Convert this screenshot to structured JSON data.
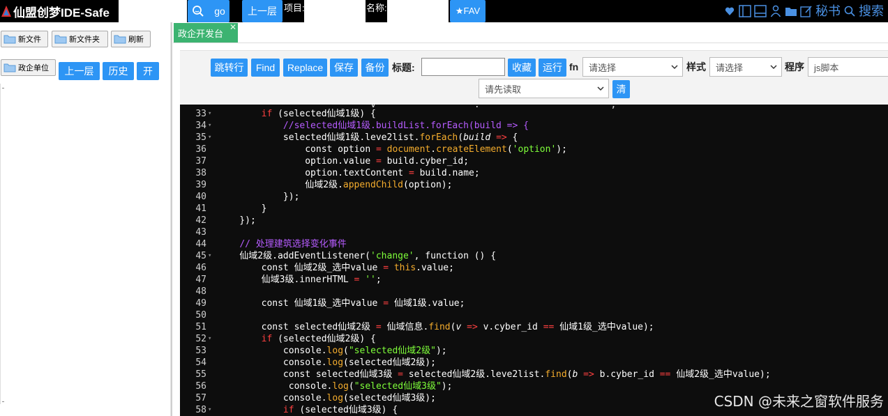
{
  "topbar": {
    "logo_text": "仙盟创梦IDE-Safe",
    "go_label": "go",
    "up_label": "上一层",
    "project_label": "项目:",
    "project_value": "",
    "name_label": "名称:",
    "name_value": "",
    "fav_label": "★FAV",
    "secretary_label": "秘书",
    "search_label": "搜索"
  },
  "left": {
    "new_file": "新文件",
    "new_folder": "新文件夹",
    "refresh": "刷新",
    "gov_unit": "政企单位",
    "up": "上一层",
    "history": "历史",
    "open": "开"
  },
  "tab": {
    "label": "政企开发台",
    "close": "✕"
  },
  "toolbar": {
    "jump": "跳转行",
    "find": "Find",
    "replace": "Replace",
    "save": "保存",
    "backup": "备份",
    "title_label": "标题:",
    "title_value": "",
    "collect": "收藏",
    "run": "运行",
    "fn_label": "fn",
    "fn_select": "请选择",
    "style_label": "样式",
    "style_select": "请选择",
    "program_label": "程序",
    "program_value": "js脚本",
    "read_select": "请先读取",
    "clear": "清"
  },
  "editor": {
    "lines": [
      {
        "n": "33",
        "fold": true
      },
      {
        "n": "34",
        "fold": true
      },
      {
        "n": "35",
        "fold": true
      },
      {
        "n": "36",
        "fold": false
      },
      {
        "n": "37",
        "fold": false
      },
      {
        "n": "38",
        "fold": false
      },
      {
        "n": "39",
        "fold": false
      },
      {
        "n": "40",
        "fold": false
      },
      {
        "n": "41",
        "fold": false
      },
      {
        "n": "42",
        "fold": false
      },
      {
        "n": "43",
        "fold": false
      },
      {
        "n": "44",
        "fold": false
      },
      {
        "n": "45",
        "fold": true
      },
      {
        "n": "46",
        "fold": false
      },
      {
        "n": "47",
        "fold": false
      },
      {
        "n": "48",
        "fold": false
      },
      {
        "n": "49",
        "fold": false
      },
      {
        "n": "50",
        "fold": false
      },
      {
        "n": "51",
        "fold": false
      },
      {
        "n": "52",
        "fold": true
      },
      {
        "n": "53",
        "fold": false
      },
      {
        "n": "54",
        "fold": false
      },
      {
        "n": "55",
        "fold": false
      },
      {
        "n": "56",
        "fold": false
      },
      {
        "n": "57",
        "fold": false
      },
      {
        "n": "58",
        "fold": true
      }
    ]
  },
  "watermark": "CSDN @未来之窗软件服务"
}
